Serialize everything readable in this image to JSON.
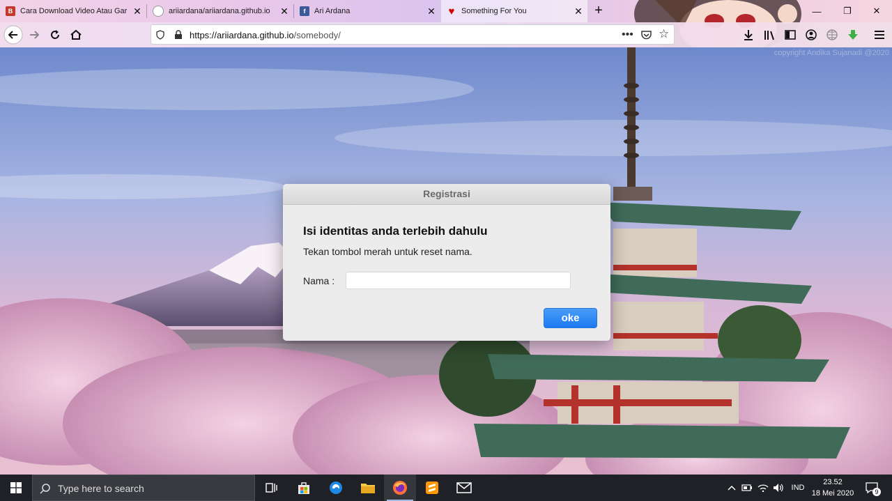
{
  "browser": {
    "tabs": [
      {
        "title": "Cara Download Video Atau Gar",
        "favicon": "blogger-icon"
      },
      {
        "title": "ariiardana/ariiardana.github.io",
        "favicon": "github-icon"
      },
      {
        "title": "Ari Ardana",
        "favicon": "facebook-icon"
      },
      {
        "title": "Something For You",
        "favicon": "heart-icon",
        "active": true
      }
    ],
    "url_host": "https://ariiardana.github.io",
    "url_path": "/somebody/"
  },
  "page": {
    "copyright": "copyright Andika Sujanadi @2020"
  },
  "dialog": {
    "title": "Registrasi",
    "heading": "Isi identitas anda terlebih dahulu",
    "instruction": "Tekan tombol merah untuk reset nama.",
    "name_label": "Nama :",
    "name_value": "",
    "ok_label": "oke"
  },
  "taskbar": {
    "search_placeholder": "Type here to search",
    "language": "IND",
    "time": "23.52",
    "date": "18 Mei 2020",
    "notification_count": "9"
  },
  "colors": {
    "ok_button": "#1b7aee",
    "taskbar": "#1f2127"
  }
}
